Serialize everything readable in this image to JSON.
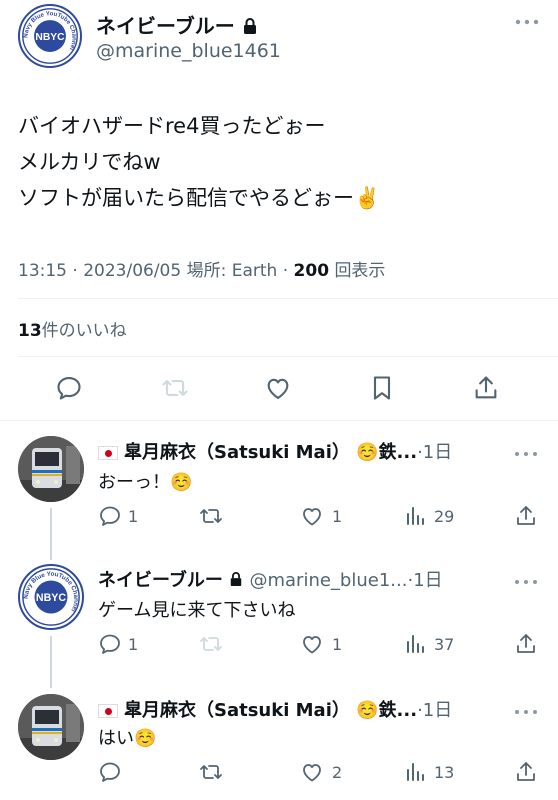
{
  "main_tweet": {
    "display_name": "ネイビーブルー",
    "handle": "@marine_blue1461",
    "avatar_text": "NBYC",
    "avatar_ring_text": "Navy Blue YouTube Channel",
    "body_lines": [
      "バイオハザードre4買ったどぉー",
      "メルカリでねw",
      "ソフトが届いたら配信でやるどぉー✌️"
    ],
    "timestamp": "13:15 · 2023/06/05",
    "location_label": "場所: Earth ·",
    "views_count": "200",
    "views_label": "回表示",
    "likes_count": "13",
    "likes_label": "件のいいね",
    "more_icon": "more-dots-icon"
  },
  "replies": [
    {
      "flag": "japan-flag-icon",
      "display_name": "皐月麻衣（Satsuki Mai） ☺️鉄...",
      "handle": "",
      "time": "·1日",
      "text": "おーっ！☺️",
      "reply_count": "1",
      "retweet_count": "",
      "like_count": "1",
      "view_count": "29"
    },
    {
      "display_name": "ネイビーブルー",
      "handle": "@marine_blue1...",
      "time": "·1日",
      "text": "ゲーム見に来て下さいね",
      "reply_count": "1",
      "retweet_count": "",
      "like_count": "1",
      "view_count": "37"
    },
    {
      "flag": "japan-flag-icon",
      "display_name": "皐月麻衣（Satsuki Mai） ☺️鉄...",
      "handle": "",
      "time": "·1日",
      "text": "はい☺️",
      "reply_count": "",
      "retweet_count": "",
      "like_count": "2",
      "view_count": "13"
    }
  ],
  "colors": {
    "text_primary": "#0f1419",
    "text_secondary": "#536471",
    "divider": "#eff3f4",
    "avatar_ring": "#2e4a9e"
  }
}
